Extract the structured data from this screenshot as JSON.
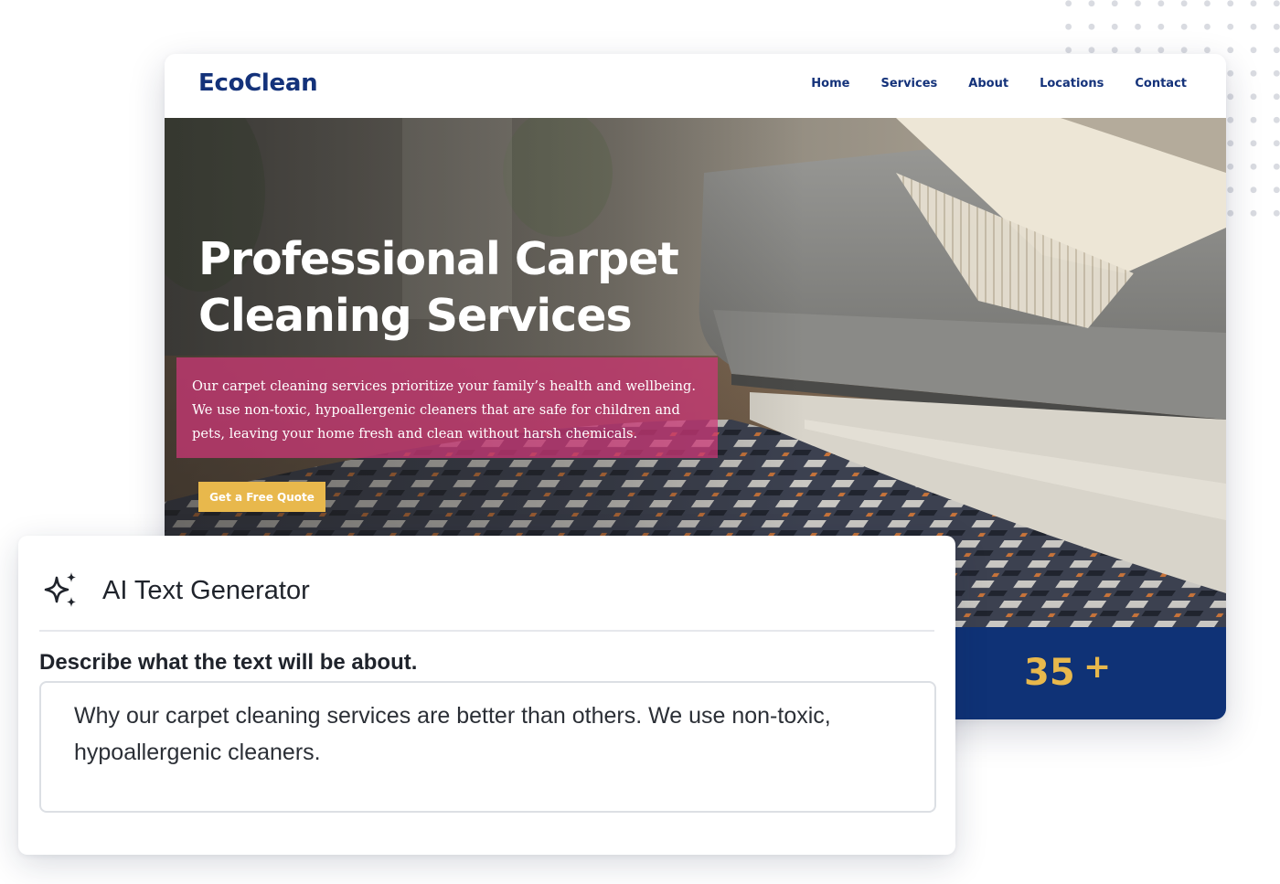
{
  "site": {
    "logo": "EcoClean",
    "nav": [
      "Home",
      "Services",
      "About",
      "Locations",
      "Contact"
    ],
    "hero": {
      "title": "Professional Carpet Cleaning Services",
      "description": "Our carpet cleaning services prioritize your family’s health and wellbeing. We use non-toxic, hypoallergenic cleaners that are safe for children and pets, leaving your home fresh and clean without harsh chemicals.",
      "cta_label": "Get a Free Quote"
    },
    "stat": {
      "value": "35",
      "suffix": "+"
    }
  },
  "ai_panel": {
    "icon": "sparkles-icon",
    "title": "AI Text Generator",
    "prompt_label": "Describe what the text will be about.",
    "prompt_value": "Why our carpet cleaning services are better than others. We use non-toxic, hypoallergenic cleaners."
  },
  "colors": {
    "brand_navy": "#14327a",
    "accent_gold": "#e8b84c",
    "overlay_pink": "#d03778",
    "stat_band": "#0f3276"
  }
}
